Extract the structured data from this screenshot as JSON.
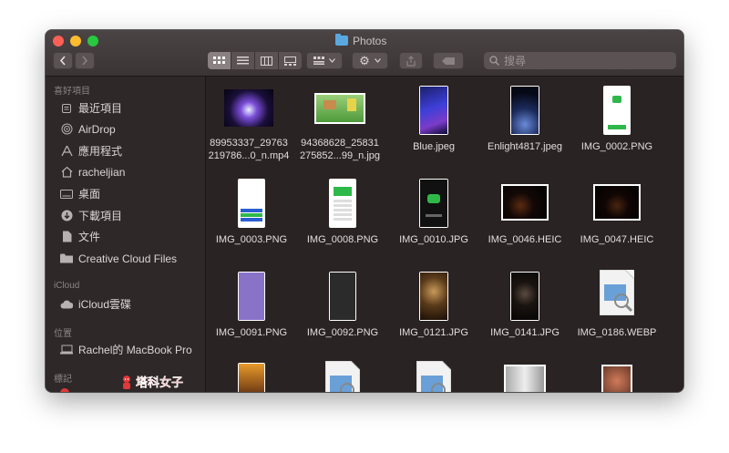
{
  "window": {
    "title": "Photos"
  },
  "toolbar": {
    "back_icon": "chevron-left-icon",
    "forward_icon": "chevron-right-icon",
    "views": [
      "icon-view",
      "list-view",
      "column-view",
      "gallery-view"
    ],
    "active_view": "icon-view",
    "search_placeholder": "搜尋"
  },
  "sidebar": {
    "favorites_heading": "喜好項目",
    "favorites": [
      {
        "label": "最近項目",
        "icon": "recents-icon"
      },
      {
        "label": "AirDrop",
        "icon": "airdrop-icon"
      },
      {
        "label": "應用程式",
        "icon": "applications-icon"
      },
      {
        "label": "racheljian",
        "icon": "home-icon"
      },
      {
        "label": "桌面",
        "icon": "desktop-icon"
      },
      {
        "label": "下載項目",
        "icon": "downloads-icon"
      },
      {
        "label": "文件",
        "icon": "documents-icon"
      },
      {
        "label": "Creative Cloud Files",
        "icon": "folder-icon"
      }
    ],
    "icloud_heading": "iCloud",
    "icloud": [
      {
        "label": "iCloud雲碟",
        "icon": "cloud-icon"
      }
    ],
    "locations_heading": "位置",
    "locations": [
      {
        "label": "Rachel的 MacBook Pro",
        "icon": "laptop-icon"
      }
    ],
    "tags_heading": "標記",
    "watermark": "塔科女子"
  },
  "files": [
    {
      "line1": "89953337_29763",
      "line2": "219786...0_n.mp4"
    },
    {
      "line1": "94368628_25831",
      "line2": "275852...99_n.jpg"
    },
    {
      "line1": "Blue.jpeg",
      "line2": ""
    },
    {
      "line1": "Enlight4817.jpeg",
      "line2": ""
    },
    {
      "line1": "IMG_0002.PNG",
      "line2": ""
    },
    {
      "line1": "IMG_0003.PNG",
      "line2": ""
    },
    {
      "line1": "IMG_0008.PNG",
      "line2": ""
    },
    {
      "line1": "IMG_0010.JPG",
      "line2": ""
    },
    {
      "line1": "IMG_0046.HEIC",
      "line2": ""
    },
    {
      "line1": "IMG_0047.HEIC",
      "line2": ""
    },
    {
      "line1": "IMG_0091.PNG",
      "line2": ""
    },
    {
      "line1": "IMG_0092.PNG",
      "line2": ""
    },
    {
      "line1": "IMG_0121.JPG",
      "line2": ""
    },
    {
      "line1": "IMG_0141.JPG",
      "line2": ""
    },
    {
      "line1": "IMG_0186.WEBP",
      "line2": ""
    }
  ]
}
